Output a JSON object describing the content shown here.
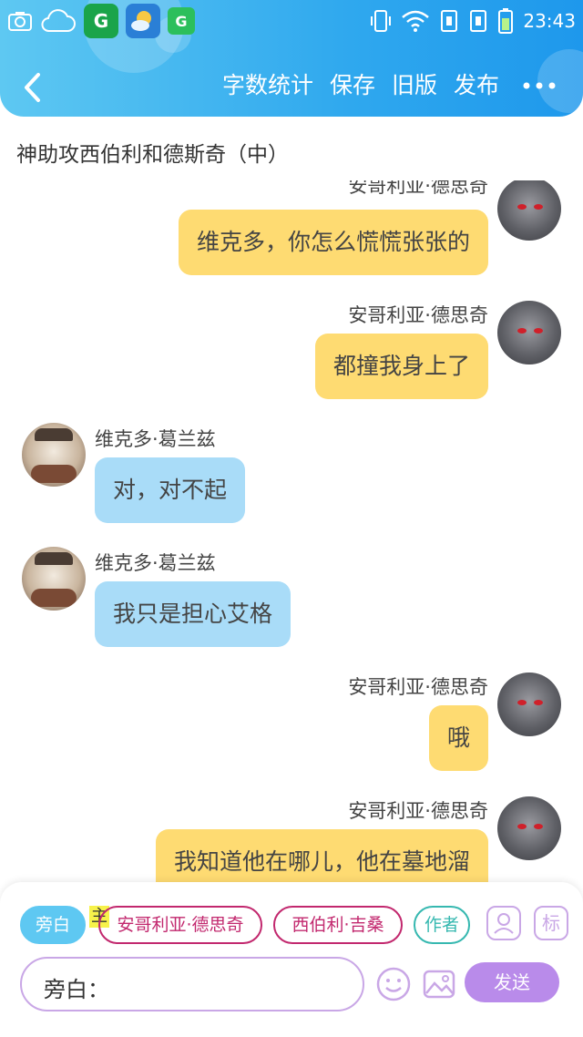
{
  "status_bar": {
    "time": "23:43",
    "left_icons": [
      "camera-icon",
      "cloud-icon",
      "app-green-icon",
      "weather-app-icon",
      "app-green-small-icon"
    ],
    "right_icons": [
      "vibrate-icon",
      "wifi-icon",
      "sim1-icon",
      "sim2-icon",
      "battery-icon"
    ]
  },
  "app_tile_glyph": "G",
  "nav": {
    "back_icon": "chevron-left-icon",
    "actions": [
      "字数统计",
      "保存",
      "旧版",
      "发布"
    ],
    "more_icon": "more-icon"
  },
  "document": {
    "title": "神助攻西伯利和德斯奇（中）"
  },
  "messages": [
    {
      "side": "right",
      "sender": "安哥利亚·德思奇",
      "text": "维克多，你怎么慌慌张张的",
      "bubble_color": "#fedb72"
    },
    {
      "side": "right",
      "sender": "安哥利亚·德思奇",
      "text": "都撞我身上了",
      "bubble_color": "#fedb72"
    },
    {
      "side": "left",
      "sender": "维克多·葛兰兹",
      "text": "对，对不起",
      "bubble_color": "#a9dcf8"
    },
    {
      "side": "left",
      "sender": "维克多·葛兰兹",
      "text": "我只是担心艾格",
      "bubble_color": "#a9dcf8"
    },
    {
      "side": "right",
      "sender": "安哥利亚·德思奇",
      "text": "哦",
      "bubble_color": "#fedb72"
    },
    {
      "side": "right",
      "sender": "安哥利亚·德思奇",
      "text": "我知道他在哪儿，他在墓地溜",
      "bubble_color": "#fedb72"
    }
  ],
  "composer": {
    "chips": [
      "旁白",
      "安哥利亚·德思奇",
      "西伯利·吉桑",
      "作者"
    ],
    "main_tag": "主",
    "role_icon": "user-card-icon",
    "tag_icon_label": "标",
    "input_value": "旁白：",
    "emoji_icon": "emoji-icon",
    "image_icon": "image-icon",
    "send_label": "发送"
  },
  "colors": {
    "header_gradient_start": "#5ec8f2",
    "header_gradient_end": "#1e98ec",
    "bubble_self": "#fedb72",
    "bubble_other": "#a9dcf8",
    "send_button": "#b98bea",
    "chip_border": "#c2286e",
    "active_chip": "#5ec8f2"
  }
}
